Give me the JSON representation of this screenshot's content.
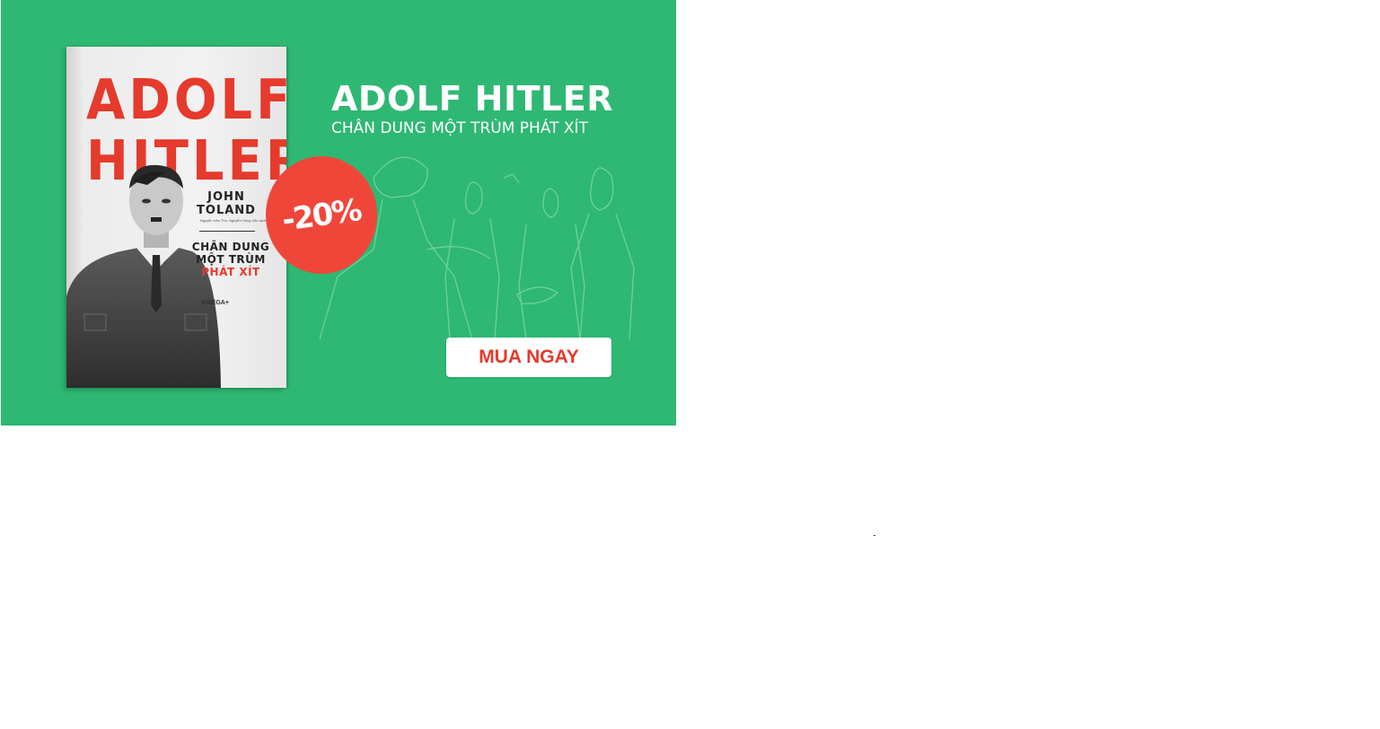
{
  "banner": {
    "background_color": "#2eb873",
    "accent_color": "#e53a2c",
    "book_cover": {
      "title_line1": "ADOLF",
      "title_line2": "HITLER",
      "author_line1": "JOHN",
      "author_line2": "TOLAND",
      "translators": "Nguyễn Văn Thu, Nguyễn Hồng Vân dịch",
      "subtitle_line1": "CHÂN DUNG",
      "subtitle_line2": "MỘT TRÙM",
      "subtitle_line3": "PHÁT XÍT",
      "publisher": "⊕MEGA+"
    },
    "discount_badge": "-20%",
    "headline": "ADOLF HITLER",
    "subheadline": "CHÂN DUNG MỘT TRÙM PHÁT XÍT",
    "cta_label": "MUA NGAY"
  }
}
